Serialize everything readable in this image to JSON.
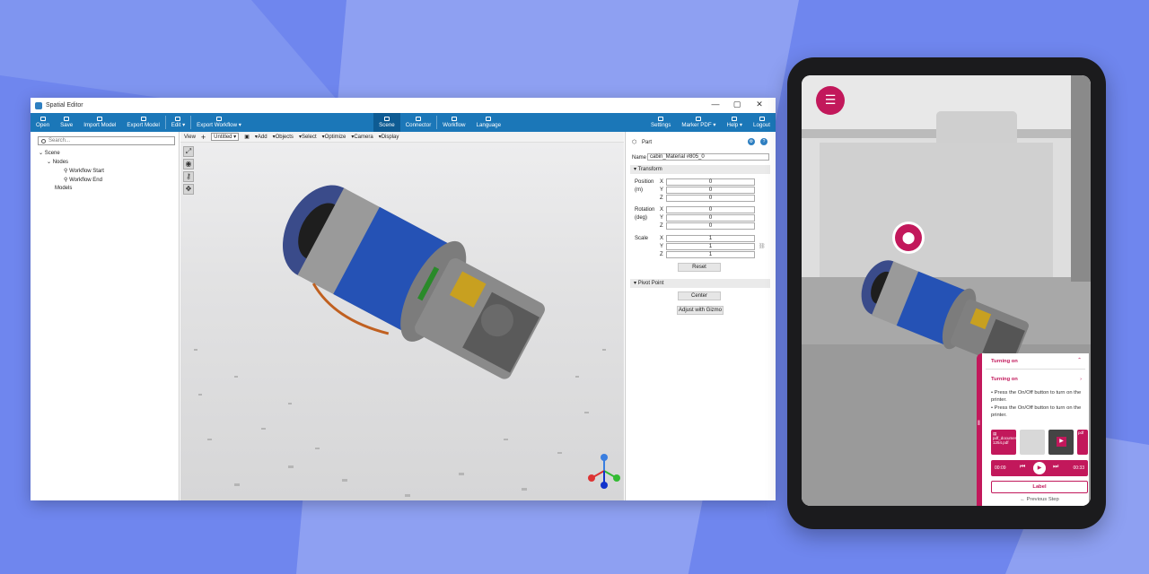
{
  "window": {
    "title": "Spatial Editor",
    "controls": {
      "minimize": "—",
      "maximize": "▢",
      "close": "✕"
    }
  },
  "toolbar": {
    "open": "Open",
    "save": "Save",
    "import_model": "Import Model",
    "export_model": "Export Model",
    "edit": "Edit ▾",
    "export_workflow": "Export Workflow ▾",
    "scene": "Scene",
    "connector": "Connector",
    "workflow": "Workflow",
    "language": "Language",
    "settings": "Settings",
    "marker_pdf": "Marker PDF ▾",
    "help": "Help ▾",
    "logout": "Logout"
  },
  "left": {
    "search_placeholder": "Search...",
    "tree": {
      "scene": "Scene",
      "nodes": "Nodes",
      "workflow_start": "Workflow Start",
      "workflow_end": "Workflow End",
      "models": "Models"
    }
  },
  "viewbar": {
    "view": "View",
    "untitled": "Untitled",
    "add": "Add",
    "objects": "Objects",
    "select": "Select",
    "optimize": "Optimize",
    "camera": "Camera",
    "display": "Display"
  },
  "right": {
    "part": "Part",
    "name_label": "Name",
    "name_value": "cabin_Material #805_0",
    "transform": "Transform",
    "position_label": "Position",
    "position_unit": "(m)",
    "position": [
      "0",
      "0",
      "0"
    ],
    "rotation_label": "Rotation",
    "rotation_unit": "(deg)",
    "rotation": [
      "0",
      "0",
      "0"
    ],
    "scale_label": "Scale",
    "scale": [
      "1",
      "1",
      "1"
    ],
    "axes": [
      "X",
      "Y",
      "Z"
    ],
    "reset": "Reset",
    "pivot_point": "Pivot Point",
    "center": "Center",
    "adjust_with_gizmo": "Adjust with Gizmo"
  },
  "ar_panel": {
    "header": "Turning on",
    "step_title": "Turning on",
    "bullet1": "Press the On/Off button to turn on the printer.",
    "bullet2": "Press the On/Off button to turn on the printer.",
    "thumb_file": "pdf_document-1254.pdf",
    "thumb_file_short": "pdf",
    "time_start": "00:09",
    "time_end": "00:33",
    "label_button": "Label",
    "previous_step": "Previous Step"
  },
  "colors": {
    "brand_blue": "#1b77b8",
    "accent_pink": "#c2185b",
    "background": "#6f86ee"
  }
}
